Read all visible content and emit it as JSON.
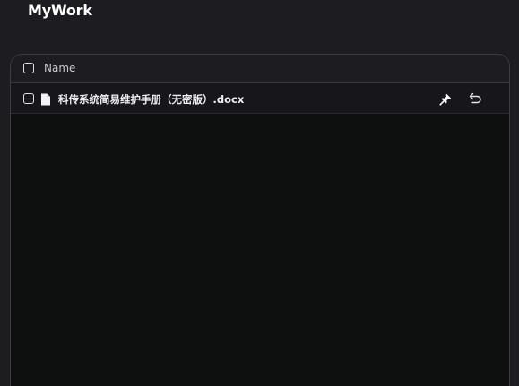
{
  "app": {
    "title": "MyWork"
  },
  "table": {
    "header": {
      "name_label": "Name"
    },
    "rows": [
      {
        "name": "科传系统简易维护手册（无密版）.docx"
      }
    ]
  },
  "icons": {
    "file": "document-icon",
    "pin": "pin-icon",
    "undo": "undo-icon"
  },
  "colors": {
    "background": "#1d1c21",
    "panel": "#0e1010",
    "row": "#17171b",
    "text": "#f0f0f2"
  }
}
